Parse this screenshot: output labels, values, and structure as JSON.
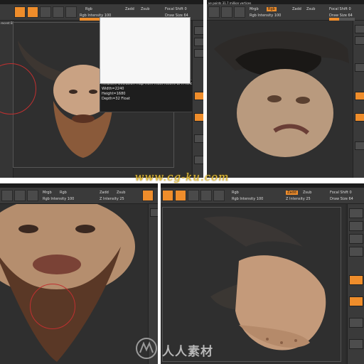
{
  "panels": {
    "top_left": {
      "header": "recent BPR render",
      "toolbar": {
        "rgb": "Rgb",
        "intensity": "Rgb Intensity 100",
        "zadd": "Zadd",
        "zsub": "Zsub",
        "focal": "Focal Shift 0",
        "draw": "Draw Size 64"
      },
      "info": {
        "title": "Ambient Occlusion Map from most recent BPR render",
        "width": "Width=2240",
        "height": "Height=1680",
        "depth": "Depth=32 Float"
      }
    },
    "top_right": {
      "header": "ve points 31.7 million vertices",
      "toolbar": {
        "mrgb": "Mrgb",
        "rgb": "Rgb",
        "intensity": "Rgb Intensity 100",
        "zadd": "Zadd",
        "zsub": "Zsub",
        "focal": "Focal Shift 0",
        "draw": "Draw Size 64"
      }
    },
    "bottom_left": {
      "toolbar": {
        "mrgb": "Mrgb",
        "rgb": "Rgb",
        "intensity": "Rgb Intensity 100",
        "zadd": "Zadd",
        "zsub": "Zsub",
        "zintensity": "Z Intensity 25"
      }
    },
    "bottom_right": {
      "toolbar": {
        "rgb": "Rgb",
        "intensity": "Rgb Intensity 100",
        "zadd": "Zadd",
        "zsub": "Zsub",
        "zintensity": "Z Intensity 25",
        "focal": "Focal Shift 0",
        "draw": "Draw Size 64"
      }
    }
  },
  "watermarks": {
    "url": "www.cg-ku.com",
    "brand": "人人素材"
  },
  "colors": {
    "accent": "#ef8d2b",
    "panel_bg": "#2b2b2b",
    "watermark_gold": "#e8c23a"
  }
}
